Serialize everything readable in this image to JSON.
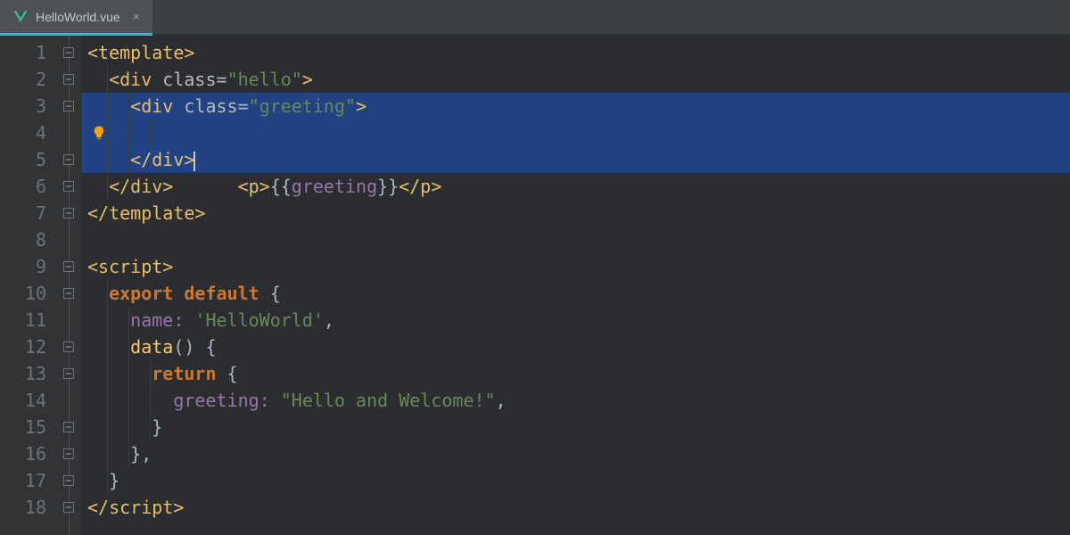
{
  "tab": {
    "filename": "HelloWorld.vue"
  },
  "gutter": {
    "numbers": [
      "1",
      "2",
      "3",
      "4",
      "5",
      "6",
      "7",
      "8",
      "9",
      "10",
      "11",
      "12",
      "13",
      "14",
      "15",
      "16",
      "17",
      "18"
    ]
  },
  "code": {
    "l1": {
      "a": "<template>"
    },
    "l2": {
      "a": "<div",
      "b": " class",
      "c": "=",
      "d": "\"hello\"",
      "e": ">"
    },
    "l3": {
      "a": "<div",
      "b": " class",
      "c": "=",
      "d": "\"greeting\"",
      "e": ">"
    },
    "l4": {
      "a": "<p>",
      "b": "{{",
      "c": "greeting",
      "d": "}}",
      "e": "</p>"
    },
    "l5": {
      "a": "</div>"
    },
    "l6": {
      "a": "</div>"
    },
    "l7": {
      "a": "</template>"
    },
    "l9": {
      "a": "<script>"
    },
    "l10": {
      "a": "export ",
      "b": "default ",
      "c": "{"
    },
    "l11": {
      "a": "name: ",
      "b": "'HelloWorld'",
      "c": ","
    },
    "l12": {
      "a": "data",
      "b": "() {"
    },
    "l13": {
      "a": "return ",
      "b": "{"
    },
    "l14": {
      "a": "greeting: ",
      "b": "\"Hello and Welcome!\"",
      "c": ","
    },
    "l15": {
      "a": "}"
    },
    "l16": {
      "a": "},"
    },
    "l17": {
      "a": "}"
    },
    "l18": {
      "a": "<",
      "b": "/script>"
    }
  }
}
